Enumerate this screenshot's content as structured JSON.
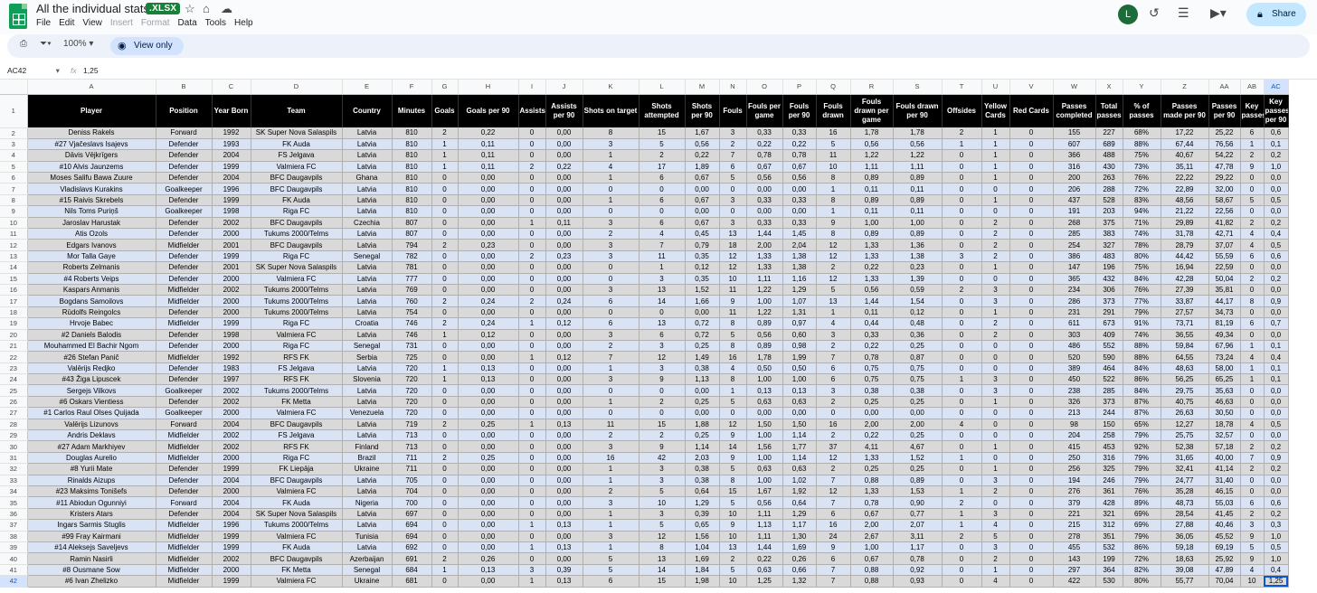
{
  "doc": {
    "title": "All the individual stats",
    "badge": ".XLSX"
  },
  "menu": [
    "File",
    "Edit",
    "View",
    "Insert",
    "Format",
    "Data",
    "Tools",
    "Help"
  ],
  "menu_dim": [
    false,
    false,
    false,
    true,
    true,
    false,
    false,
    false
  ],
  "user": {
    "initial": "L"
  },
  "share_label": "Share",
  "toolbar": {
    "zoom": "100%",
    "view_only": "View only"
  },
  "formula_bar": {
    "cell_ref": "AC42",
    "fx": "fx",
    "value": "1,25"
  },
  "columns": [
    "A",
    "B",
    "C",
    "D",
    "E",
    "F",
    "G",
    "H",
    "I",
    "J",
    "K",
    "L",
    "M",
    "N",
    "O",
    "P",
    "Q",
    "R",
    "S",
    "T",
    "U",
    "V",
    "W",
    "X",
    "Y",
    "Z",
    "AA",
    "AB",
    "AC"
  ],
  "headers": [
    "Player",
    "Position",
    "Year Born",
    "Team",
    "Country",
    "Minutes",
    "Goals",
    "Goals per 90",
    "Assists",
    "Assists per 90",
    "Shots on target",
    "Shots attempted",
    "Shots per 90",
    "Fouls",
    "Fouls per game",
    "Fouls per 90",
    "Fouls drawn",
    "Fouls drawn per game",
    "Fouls drawn per 90",
    "Offsides",
    "Yellow Cards",
    "Red Cards",
    "Passes completed",
    "Total passes",
    "% of passes",
    "Passes made per 90",
    "Passes per 90",
    "Key passes",
    "Key passes per 90"
  ],
  "rows": [
    [
      "Deniss Rakels",
      "Forward",
      "1992",
      "SK Super Nova Salaspils",
      "Latvia",
      "810",
      "2",
      "0,22",
      "0",
      "0,00",
      "8",
      "15",
      "1,67",
      "3",
      "0,33",
      "0,33",
      "16",
      "1,78",
      "1,78",
      "2",
      "1",
      "0",
      "155",
      "227",
      "68%",
      "17,22",
      "25,22",
      "6",
      "0,6"
    ],
    [
      "#27 Vjačeslavs Isajevs",
      "Defender",
      "1993",
      "FK Auda",
      "Latvia",
      "810",
      "1",
      "0,11",
      "0",
      "0,00",
      "3",
      "5",
      "0,56",
      "2",
      "0,22",
      "0,22",
      "5",
      "0,56",
      "0,56",
      "1",
      "1",
      "0",
      "607",
      "689",
      "88%",
      "67,44",
      "76,56",
      "1",
      "0,1"
    ],
    [
      "Dāvis Vējkrīgers",
      "Defender",
      "2004",
      "FS Jelgava",
      "Latvia",
      "810",
      "1",
      "0,11",
      "0",
      "0,00",
      "1",
      "2",
      "0,22",
      "7",
      "0,78",
      "0,78",
      "11",
      "1,22",
      "1,22",
      "0",
      "1",
      "0",
      "366",
      "488",
      "75%",
      "40,67",
      "54,22",
      "2",
      "0,2"
    ],
    [
      "#10 Alvis Jaunzems",
      "Defender",
      "1999",
      "Valmiera FC",
      "Latvia",
      "810",
      "1",
      "0,11",
      "2",
      "0,22",
      "4",
      "17",
      "1,89",
      "6",
      "0,67",
      "0,67",
      "10",
      "1,11",
      "1,11",
      "0",
      "1",
      "0",
      "316",
      "430",
      "73%",
      "35,11",
      "47,78",
      "9",
      "1,0"
    ],
    [
      "Moses Salifu Bawa Zuure",
      "Defender",
      "2004",
      "BFC Daugavpils",
      "Ghana",
      "810",
      "0",
      "0,00",
      "0",
      "0,00",
      "1",
      "6",
      "0,67",
      "5",
      "0,56",
      "0,56",
      "8",
      "0,89",
      "0,89",
      "0",
      "1",
      "0",
      "200",
      "263",
      "76%",
      "22,22",
      "29,22",
      "0",
      "0,0"
    ],
    [
      "Vladislavs Kurakins",
      "Goalkeeper",
      "1996",
      "BFC Daugavpils",
      "Latvia",
      "810",
      "0",
      "0,00",
      "0",
      "0,00",
      "0",
      "0",
      "0,00",
      "0",
      "0,00",
      "0,00",
      "1",
      "0,11",
      "0,11",
      "0",
      "0",
      "0",
      "206",
      "288",
      "72%",
      "22,89",
      "32,00",
      "0",
      "0,0"
    ],
    [
      "#15 Raivis Skrebels",
      "Defender",
      "1999",
      "FK Auda",
      "Latvia",
      "810",
      "0",
      "0,00",
      "0",
      "0,00",
      "1",
      "6",
      "0,67",
      "3",
      "0,33",
      "0,33",
      "8",
      "0,89",
      "0,89",
      "0",
      "1",
      "0",
      "437",
      "528",
      "83%",
      "48,56",
      "58,67",
      "5",
      "0,5"
    ],
    [
      "Nils Toms Puriņš",
      "Goalkeeper",
      "1998",
      "Riga FC",
      "Latvia",
      "810",
      "0",
      "0,00",
      "0",
      "0,00",
      "0",
      "0",
      "0,00",
      "0",
      "0,00",
      "0,00",
      "1",
      "0,11",
      "0,11",
      "0",
      "0",
      "0",
      "191",
      "203",
      "94%",
      "21,22",
      "22,56",
      "0",
      "0,0"
    ],
    [
      "Jaroslav Harustak",
      "Defender",
      "2002",
      "BFC Daugavpils",
      "Czechia",
      "807",
      "0",
      "0,00",
      "1",
      "0,11",
      "3",
      "6",
      "0,67",
      "3",
      "0,33",
      "0,33",
      "9",
      "1,00",
      "1,00",
      "0",
      "2",
      "0",
      "268",
      "375",
      "71%",
      "29,89",
      "41,82",
      "2",
      "0,2"
    ],
    [
      "Atis Ozols",
      "Defender",
      "2000",
      "Tukums 2000/Telms",
      "Latvia",
      "807",
      "0",
      "0,00",
      "0",
      "0,00",
      "2",
      "4",
      "0,45",
      "13",
      "1,44",
      "1,45",
      "8",
      "0,89",
      "0,89",
      "0",
      "2",
      "0",
      "285",
      "383",
      "74%",
      "31,78",
      "42,71",
      "4",
      "0,4"
    ],
    [
      "Edgars Ivanovs",
      "Midfielder",
      "2001",
      "BFC Daugavpils",
      "Latvia",
      "794",
      "2",
      "0,23",
      "0",
      "0,00",
      "3",
      "7",
      "0,79",
      "18",
      "2,00",
      "2,04",
      "12",
      "1,33",
      "1,36",
      "0",
      "2",
      "0",
      "254",
      "327",
      "78%",
      "28,79",
      "37,07",
      "4",
      "0,5"
    ],
    [
      "Mor Talla Gaye",
      "Defender",
      "1999",
      "Riga FC",
      "Senegal",
      "782",
      "0",
      "0,00",
      "2",
      "0,23",
      "3",
      "11",
      "0,35",
      "12",
      "1,33",
      "1,38",
      "12",
      "1,33",
      "1,38",
      "3",
      "2",
      "0",
      "386",
      "483",
      "80%",
      "44,42",
      "55,59",
      "6",
      "0,6"
    ],
    [
      "Roberts Zelmanis",
      "Defender",
      "2001",
      "SK Super Nova Salaspils",
      "Latvia",
      "781",
      "0",
      "0,00",
      "0",
      "0,00",
      "0",
      "1",
      "0,12",
      "12",
      "1,33",
      "1,38",
      "2",
      "0,22",
      "0,23",
      "0",
      "1",
      "0",
      "147",
      "196",
      "75%",
      "16,94",
      "22,59",
      "0",
      "0,0"
    ],
    [
      "#4 Roberts Veips",
      "Defender",
      "2000",
      "Valmiera FC",
      "Latvia",
      "777",
      "0",
      "0,00",
      "0",
      "0,00",
      "0",
      "3",
      "0,35",
      "10",
      "1,11",
      "1,16",
      "12",
      "1,33",
      "1,39",
      "0",
      "0",
      "0",
      "365",
      "432",
      "84%",
      "42,28",
      "50,04",
      "2",
      "0,2"
    ],
    [
      "Kaspars Anmanis",
      "Midfielder",
      "2002",
      "Tukums 2000/Telms",
      "Latvia",
      "769",
      "0",
      "0,00",
      "0",
      "0,00",
      "3",
      "13",
      "1,52",
      "11",
      "1,22",
      "1,29",
      "5",
      "0,56",
      "0,59",
      "2",
      "3",
      "0",
      "234",
      "306",
      "76%",
      "27,39",
      "35,81",
      "0",
      "0,0"
    ],
    [
      "Bogdans Samoilovs",
      "Midfielder",
      "2000",
      "Tukums 2000/Telms",
      "Latvia",
      "760",
      "2",
      "0,24",
      "2",
      "0,24",
      "6",
      "14",
      "1,66",
      "9",
      "1,00",
      "1,07",
      "13",
      "1,44",
      "1,54",
      "0",
      "3",
      "0",
      "286",
      "373",
      "77%",
      "33,87",
      "44,17",
      "8",
      "0,9"
    ],
    [
      "Rūdolfs Reingolcs",
      "Defender",
      "2000",
      "Tukums 2000/Telms",
      "Latvia",
      "754",
      "0",
      "0,00",
      "0",
      "0,00",
      "0",
      "0",
      "0,00",
      "11",
      "1,22",
      "1,31",
      "1",
      "0,11",
      "0,12",
      "0",
      "1",
      "0",
      "231",
      "291",
      "79%",
      "27,57",
      "34,73",
      "0",
      "0,0"
    ],
    [
      "Hrvoje Babec",
      "Midfielder",
      "1999",
      "Riga FC",
      "Croatia",
      "746",
      "2",
      "0,24",
      "1",
      "0,12",
      "6",
      "13",
      "0,72",
      "8",
      "0,89",
      "0,97",
      "4",
      "0,44",
      "0,48",
      "0",
      "2",
      "0",
      "611",
      "673",
      "91%",
      "73,71",
      "81,19",
      "6",
      "0,7"
    ],
    [
      "#2 Daniels Balodis",
      "Defender",
      "1998",
      "Valmiera FC",
      "Latvia",
      "746",
      "1",
      "0,12",
      "0",
      "0,00",
      "3",
      "6",
      "0,72",
      "5",
      "0,56",
      "0,60",
      "3",
      "0,33",
      "0,36",
      "0",
      "2",
      "0",
      "303",
      "409",
      "74%",
      "36,55",
      "49,34",
      "0",
      "0,0"
    ],
    [
      "Mouhammed El Bachir Ngom",
      "Defender",
      "2000",
      "Riga FC",
      "Senegal",
      "731",
      "0",
      "0,00",
      "0",
      "0,00",
      "2",
      "3",
      "0,25",
      "8",
      "0,89",
      "0,98",
      "2",
      "0,22",
      "0,25",
      "0",
      "0",
      "0",
      "486",
      "552",
      "88%",
      "59,84",
      "67,96",
      "1",
      "0,1"
    ],
    [
      "#26 Stefan Panič",
      "Midfielder",
      "1992",
      "RFS FK",
      "Serbia",
      "725",
      "0",
      "0,00",
      "1",
      "0,12",
      "7",
      "12",
      "1,49",
      "16",
      "1,78",
      "1,99",
      "7",
      "0,78",
      "0,87",
      "0",
      "0",
      "0",
      "520",
      "590",
      "88%",
      "64,55",
      "73,24",
      "4",
      "0,4"
    ],
    [
      "Valērijs Redjko",
      "Defender",
      "1983",
      "FS Jelgava",
      "Latvia",
      "720",
      "1",
      "0,13",
      "0",
      "0,00",
      "1",
      "3",
      "0,38",
      "4",
      "0,50",
      "0,50",
      "6",
      "0,75",
      "0,75",
      "0",
      "0",
      "0",
      "389",
      "464",
      "84%",
      "48,63",
      "58,00",
      "1",
      "0,1"
    ],
    [
      "#43 Žiga Lipuscek",
      "Defender",
      "1997",
      "RFS FK",
      "Slovenia",
      "720",
      "1",
      "0,13",
      "0",
      "0,00",
      "3",
      "9",
      "1,13",
      "8",
      "1,00",
      "1,00",
      "6",
      "0,75",
      "0,75",
      "1",
      "3",
      "0",
      "450",
      "522",
      "86%",
      "56,25",
      "65,25",
      "1",
      "0,1"
    ],
    [
      "Sergejs Vilkovs",
      "Goalkeeper",
      "2002",
      "Tukums 2000/Telms",
      "Latvia",
      "720",
      "0",
      "0,00",
      "0",
      "0,00",
      "0",
      "0",
      "0,00",
      "1",
      "0,13",
      "0,13",
      "3",
      "0,38",
      "0,38",
      "0",
      "3",
      "0",
      "238",
      "285",
      "84%",
      "29,75",
      "35,63",
      "0",
      "0,0"
    ],
    [
      "#6 Oskars Vientiess",
      "Defender",
      "2002",
      "FK Metta",
      "Latvia",
      "720",
      "0",
      "0,00",
      "0",
      "0,00",
      "1",
      "2",
      "0,25",
      "5",
      "0,63",
      "0,63",
      "2",
      "0,25",
      "0,25",
      "0",
      "1",
      "0",
      "326",
      "373",
      "87%",
      "40,75",
      "46,63",
      "0",
      "0,0"
    ],
    [
      "#1 Carlos Raul Olses Quijada",
      "Goalkeeper",
      "2000",
      "Valmiera FC",
      "Venezuela",
      "720",
      "0",
      "0,00",
      "0",
      "0,00",
      "0",
      "0",
      "0,00",
      "0",
      "0,00",
      "0,00",
      "0",
      "0,00",
      "0,00",
      "0",
      "0",
      "0",
      "213",
      "244",
      "87%",
      "26,63",
      "30,50",
      "0",
      "0,0"
    ],
    [
      "Valērijs Lizunovs",
      "Forward",
      "2004",
      "BFC Daugavpils",
      "Latvia",
      "719",
      "2",
      "0,25",
      "1",
      "0,13",
      "11",
      "15",
      "1,88",
      "12",
      "1,50",
      "1,50",
      "16",
      "2,00",
      "2,00",
      "4",
      "0",
      "0",
      "98",
      "150",
      "65%",
      "12,27",
      "18,78",
      "4",
      "0,5"
    ],
    [
      "Andris Deklavs",
      "Midfielder",
      "2002",
      "FS Jelgava",
      "Latvia",
      "713",
      "0",
      "0,00",
      "0",
      "0,00",
      "2",
      "2",
      "0,25",
      "9",
      "1,00",
      "1,14",
      "2",
      "0,22",
      "0,25",
      "0",
      "0",
      "0",
      "204",
      "258",
      "79%",
      "25,75",
      "32,57",
      "0",
      "0,0"
    ],
    [
      "#27 Adam Markhiyev",
      "Midfielder",
      "2002",
      "RFS FK",
      "Finland",
      "713",
      "0",
      "0,00",
      "0",
      "0,00",
      "3",
      "9",
      "1,14",
      "14",
      "1,56",
      "1,77",
      "37",
      "4,11",
      "4,67",
      "0",
      "1",
      "0",
      "415",
      "453",
      "92%",
      "52,38",
      "57,18",
      "2",
      "0,2"
    ],
    [
      "Douglas Aurelio",
      "Midfielder",
      "2000",
      "Riga FC",
      "Brazil",
      "711",
      "2",
      "0,25",
      "0",
      "0,00",
      "16",
      "42",
      "2,03",
      "9",
      "1,00",
      "1,14",
      "12",
      "1,33",
      "1,52",
      "1",
      "0",
      "0",
      "250",
      "316",
      "79%",
      "31,65",
      "40,00",
      "7",
      "0,9"
    ],
    [
      "#8 Yurii Mate",
      "Defender",
      "1999",
      "FK Liepāja",
      "Ukraine",
      "711",
      "0",
      "0,00",
      "0",
      "0,00",
      "1",
      "3",
      "0,38",
      "5",
      "0,63",
      "0,63",
      "2",
      "0,25",
      "0,25",
      "0",
      "1",
      "0",
      "256",
      "325",
      "79%",
      "32,41",
      "41,14",
      "2",
      "0,2"
    ],
    [
      "Rinalds Aizups",
      "Defender",
      "2004",
      "BFC Daugavpils",
      "Latvia",
      "705",
      "0",
      "0,00",
      "0",
      "0,00",
      "1",
      "3",
      "0,38",
      "8",
      "1,00",
      "1,02",
      "7",
      "0,88",
      "0,89",
      "0",
      "3",
      "0",
      "194",
      "246",
      "79%",
      "24,77",
      "31,40",
      "0",
      "0,0"
    ],
    [
      "#23 Maksims Tonišefs",
      "Defender",
      "2000",
      "Valmiera FC",
      "Latvia",
      "704",
      "0",
      "0,00",
      "0",
      "0,00",
      "2",
      "5",
      "0,64",
      "15",
      "1,67",
      "1,92",
      "12",
      "1,33",
      "1,53",
      "1",
      "2",
      "0",
      "276",
      "361",
      "76%",
      "35,28",
      "46,15",
      "0",
      "0,0"
    ],
    [
      "#11 Abiodun Ogunniyi",
      "Forward",
      "2004",
      "FK Auda",
      "Nigeria",
      "700",
      "0",
      "0,00",
      "0",
      "0,00",
      "3",
      "10",
      "1,29",
      "5",
      "0,56",
      "0,64",
      "7",
      "0,78",
      "0,90",
      "2",
      "0",
      "0",
      "379",
      "428",
      "89%",
      "48,73",
      "55,03",
      "6",
      "0,6"
    ],
    [
      "Kristers Atars",
      "Defender",
      "2004",
      "SK Super Nova Salaspils",
      "Latvia",
      "697",
      "0",
      "0,00",
      "0",
      "0,00",
      "1",
      "3",
      "0,39",
      "10",
      "1,11",
      "1,29",
      "6",
      "0,67",
      "0,77",
      "1",
      "3",
      "0",
      "221",
      "321",
      "69%",
      "28,54",
      "41,45",
      "2",
      "0,2"
    ],
    [
      "Ingars Sarmis Stuglis",
      "Midfielder",
      "1996",
      "Tukums 2000/Telms",
      "Latvia",
      "694",
      "0",
      "0,00",
      "1",
      "0,13",
      "1",
      "5",
      "0,65",
      "9",
      "1,13",
      "1,17",
      "16",
      "2,00",
      "2,07",
      "1",
      "4",
      "0",
      "215",
      "312",
      "69%",
      "27,88",
      "40,46",
      "3",
      "0,3"
    ],
    [
      "#99 Fray Kairmani",
      "Midfielder",
      "1999",
      "Valmiera FC",
      "Tunisia",
      "694",
      "0",
      "0,00",
      "0",
      "0,00",
      "3",
      "12",
      "1,56",
      "10",
      "1,11",
      "1,30",
      "24",
      "2,67",
      "3,11",
      "2",
      "5",
      "0",
      "278",
      "351",
      "79%",
      "36,05",
      "45,52",
      "9",
      "1,0"
    ],
    [
      "#14 Aleksejs Saveljevs",
      "Midfielder",
      "1999",
      "FK Auda",
      "Latvia",
      "692",
      "0",
      "0,00",
      "1",
      "0,13",
      "1",
      "8",
      "1,04",
      "13",
      "1,44",
      "1,69",
      "9",
      "1,00",
      "1,17",
      "0",
      "3",
      "0",
      "455",
      "532",
      "86%",
      "59,18",
      "69,19",
      "5",
      "0,5"
    ],
    [
      "Ramin Nasirli",
      "Midfielder",
      "2002",
      "BFC Daugavpils",
      "Azerbaijan",
      "691",
      "2",
      "0,26",
      "0",
      "0,00",
      "5",
      "13",
      "1,69",
      "2",
      "0,22",
      "0,26",
      "6",
      "0,67",
      "0,78",
      "0",
      "2",
      "0",
      "143",
      "199",
      "72%",
      "18,63",
      "25,92",
      "9",
      "1,0"
    ],
    [
      "#8 Ousmane Sow",
      "Midfielder",
      "2000",
      "FK Metta",
      "Senegal",
      "684",
      "1",
      "0,13",
      "3",
      "0,39",
      "5",
      "14",
      "1,84",
      "5",
      "0,63",
      "0,66",
      "7",
      "0,88",
      "0,92",
      "0",
      "1",
      "0",
      "297",
      "364",
      "82%",
      "39,08",
      "47,89",
      "4",
      "0,4"
    ],
    [
      "#6 Ivan Zhelizko",
      "Midfielder",
      "1999",
      "Valmiera FC",
      "Ukraine",
      "681",
      "0",
      "0,00",
      "1",
      "0,13",
      "6",
      "15",
      "1,98",
      "10",
      "1,25",
      "1,32",
      "7",
      "0,88",
      "0,93",
      "0",
      "4",
      "0",
      "422",
      "530",
      "80%",
      "55,77",
      "70,04",
      "10",
      "1,25"
    ]
  ]
}
